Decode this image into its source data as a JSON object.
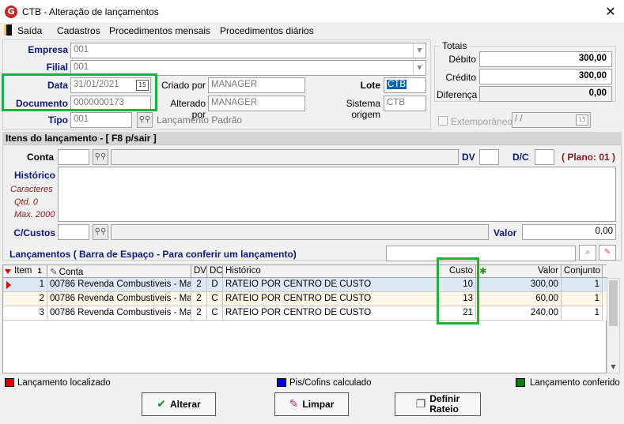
{
  "window": {
    "title": "CTB - Alteração de lançamentos",
    "logo_letter": "G",
    "close": "✕"
  },
  "menu": {
    "items": [
      "Saída",
      "Cadastros",
      "Procedimentos mensais",
      "Procedimentos diários"
    ]
  },
  "header": {
    "empresa": {
      "label": "Empresa",
      "value": "001"
    },
    "filial": {
      "label": "Filial",
      "value": "001"
    },
    "data": {
      "label": "Data",
      "value": "31/01/2021"
    },
    "documento": {
      "label": "Documento",
      "value": "0000000173"
    },
    "tipo": {
      "label": "Tipo",
      "value": "001",
      "description": "Lançamento Padrão"
    },
    "criado_por": {
      "label": "Criado por",
      "value": "MANAGER"
    },
    "alterado_por": {
      "label": "Alterado por",
      "value": "MANAGER"
    },
    "lote": {
      "label": "Lote",
      "value": "CTB"
    },
    "sistema_origem": {
      "label": "Sistema origem",
      "value": "CTB"
    }
  },
  "totais": {
    "title": "Totais",
    "debito": {
      "label": "Débito",
      "value": "300,00"
    },
    "credito": {
      "label": "Crédito",
      "value": "300,00"
    },
    "diferenca": {
      "label": "Diferença",
      "value": "0,00"
    }
  },
  "extemporaneo": {
    "label": "Extemporâneo",
    "value": " /  /"
  },
  "itens": {
    "title": "Itens do lançamento - [ F8 p/sair ]",
    "conta_label": "Conta",
    "dv_label": "DV",
    "dc_label": "D/C",
    "plano": "( Plano: 01 )",
    "historico_label": "Histórico",
    "caracteres": "Caracteres",
    "qtd": "Qtd. 0",
    "max": "Max. 2000",
    "custos_label": "C/Custos",
    "valor_label": "Valor",
    "valor_value": "0,00"
  },
  "lancamentos": {
    "title": "Lançamentos ( Barra de Espaço - Para conferir um lançamento)",
    "columns": [
      "Item",
      "Conta",
      "DV",
      "DC",
      "Histórico",
      "Custo",
      "Valor",
      "Conjunto"
    ],
    "sort_badge": "1",
    "rows": [
      {
        "item": "1",
        "conta": "00786 Revenda Combustiveis - Ma...",
        "dv": "2",
        "dc": "D",
        "historico": "RATEIO POR CENTRO DE CUSTO",
        "custo": "10",
        "valor": "300,00",
        "conjunto": "1"
      },
      {
        "item": "2",
        "conta": "00786 Revenda Combustiveis - Ma...",
        "dv": "2",
        "dc": "C",
        "historico": "RATEIO POR CENTRO DE CUSTO",
        "custo": "13",
        "valor": "60,00",
        "conjunto": "1"
      },
      {
        "item": "3",
        "conta": "00786 Revenda Combustiveis - Ma...",
        "dv": "2",
        "dc": "C",
        "historico": "RATEIO POR CENTRO DE CUSTO",
        "custo": "21",
        "valor": "240,00",
        "conjunto": "1"
      }
    ]
  },
  "legend": {
    "localizado": {
      "label": "Lançamento localizado",
      "color": "#e00000"
    },
    "pis": {
      "label": "Pis/Cofins calculado",
      "color": "#0000e0"
    },
    "conferido": {
      "label": "Lançamento conferido",
      "color": "#008000"
    }
  },
  "buttons": {
    "alterar": "Alterar",
    "limpar": "Limpar",
    "definir_line1": "Definir",
    "definir_line2": "Rateio"
  },
  "colors": {
    "highlight_box": "#1faf3b",
    "row_selected": "#dce9f5",
    "row_alt": "#fdf7e7",
    "label_blue": "#0b1a78"
  }
}
